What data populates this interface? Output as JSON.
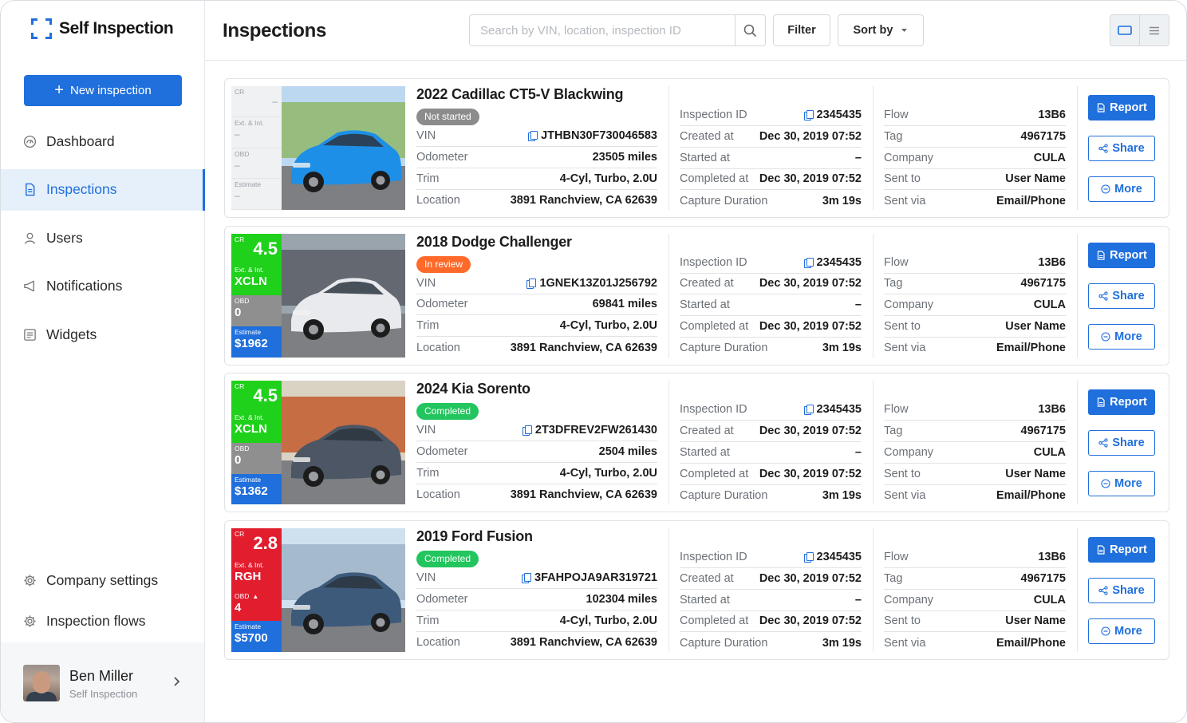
{
  "app": {
    "brand": "Self Inspection"
  },
  "sidebar": {
    "new_button": "New inspection",
    "nav": [
      {
        "id": "dashboard",
        "label": "Dashboard",
        "icon": "gauge-icon",
        "active": false
      },
      {
        "id": "inspections",
        "label": "Inspections",
        "icon": "document-icon",
        "active": true
      },
      {
        "id": "users",
        "label": "Users",
        "icon": "user-icon",
        "active": false
      },
      {
        "id": "notifications",
        "label": "Notifications",
        "icon": "megaphone-icon",
        "active": false
      },
      {
        "id": "widgets",
        "label": "Widgets",
        "icon": "widget-icon",
        "active": false
      }
    ],
    "bottom_nav": [
      {
        "id": "company-settings",
        "label": "Company settings",
        "icon": "gear-icon"
      },
      {
        "id": "inspection-flows",
        "label": "Inspection flows",
        "icon": "gear-icon"
      }
    ],
    "user": {
      "name": "Ben Miller",
      "subtitle": "Self Inspection"
    }
  },
  "header": {
    "title": "Inspections",
    "search_placeholder": "Search by VIN, location, inspection ID",
    "filter_label": "Filter",
    "sort_label": "Sort by"
  },
  "labels": {
    "vin": "VIN",
    "odometer": "Odometer",
    "trim": "Trim",
    "location": "Location",
    "inspection_id": "Inspection  ID",
    "created_at": "Created at",
    "started_at": "Started at",
    "completed_at": "Completed at",
    "capture_duration": "Capture Duration",
    "flow": "Flow",
    "tag": "Tag",
    "company": "Company",
    "sent_to": "Sent to",
    "sent_via": "Sent via",
    "report": "Report",
    "share": "Share",
    "more": "More",
    "cr": "CR",
    "ext_int": "Ext. & Int.",
    "obd": "OBD",
    "estimate": "Estimate"
  },
  "colors": {
    "accent": "#1f6fdc",
    "green": "#22c55e",
    "lime": "#1fd11a",
    "gray": "#8f8f8f",
    "red": "#e11d2e",
    "orange": "#ff6a2b",
    "status_gray": "#8c8c8c"
  },
  "inspections": [
    {
      "title": "2022 Cadillac CT5-V Blackwing",
      "status": "Not started",
      "status_color": "#8c8c8c",
      "scores": {
        "cr": "–",
        "ext_int": "–",
        "obd": "–",
        "estimate": "–",
        "empty": true
      },
      "photo_color": "#1e8fe6",
      "vin": "JTHBN30F730046583",
      "odometer": "23505 miles",
      "trim": "4-Cyl, Turbo, 2.0U",
      "location": "3891 Ranchview, CA 62639",
      "inspection_id": "2345435",
      "created_at": "Dec 30, 2019 07:52",
      "started_at": "–",
      "completed_at": "Dec 30, 2019 07:52",
      "capture_duration": "3m 19s",
      "flow": "13B6",
      "tag": "4967175",
      "company": "CULA",
      "sent_to": "User Name",
      "sent_via": "Email/Phone"
    },
    {
      "title": "2018 Dodge Challenger",
      "status": "In review",
      "status_color": "#ff6a2b",
      "scores": {
        "cr": "4.5",
        "ext_int": "XCLN",
        "obd": "0",
        "estimate": "$1962",
        "cr_color": "#1fd11a",
        "ext_color": "#1fd11a",
        "obd_color": "#8f8f8f",
        "est_color": "#1f6fdc",
        "obd_warn": false,
        "empty": false
      },
      "photo_color": "#e8eaed",
      "vin": "1GNEK13Z01J256792",
      "odometer": "69841 miles",
      "trim": "4-Cyl, Turbo, 2.0U",
      "location": "3891 Ranchview, CA 62639",
      "inspection_id": "2345435",
      "created_at": "Dec 30, 2019 07:52",
      "started_at": "–",
      "completed_at": "Dec 30, 2019 07:52",
      "capture_duration": "3m 19s",
      "flow": "13B6",
      "tag": "4967175",
      "company": "CULA",
      "sent_to": "User Name",
      "sent_via": "Email/Phone"
    },
    {
      "title": "2024 Kia Sorento",
      "status": "Completed",
      "status_color": "#22c55e",
      "scores": {
        "cr": "4.5",
        "ext_int": "XCLN",
        "obd": "0",
        "estimate": "$1362",
        "cr_color": "#1fd11a",
        "ext_color": "#1fd11a",
        "obd_color": "#8f8f8f",
        "est_color": "#1f6fdc",
        "obd_warn": false,
        "empty": false
      },
      "photo_color": "#4c5664",
      "vin": "2T3DFREV2FW261430",
      "odometer": "2504 miles",
      "trim": "4-Cyl, Turbo, 2.0U",
      "location": "3891 Ranchview, CA 62639",
      "inspection_id": "2345435",
      "created_at": "Dec 30, 2019 07:52",
      "started_at": "–",
      "completed_at": "Dec 30, 2019 07:52",
      "capture_duration": "3m 19s",
      "flow": "13B6",
      "tag": "4967175",
      "company": "CULA",
      "sent_to": "User Name",
      "sent_via": "Email/Phone"
    },
    {
      "title": "2019 Ford Fusion",
      "status": "Completed",
      "status_color": "#22c55e",
      "scores": {
        "cr": "2.8",
        "ext_int": "RGH",
        "obd": "4",
        "estimate": "$5700",
        "cr_color": "#e11d2e",
        "ext_color": "#e11d2e",
        "obd_color": "#e11d2e",
        "est_color": "#1f6fdc",
        "obd_warn": true,
        "empty": false
      },
      "photo_color": "#3d5a7a",
      "vin": "3FAHPOJA9AR319721",
      "odometer": "102304 miles",
      "trim": "4-Cyl, Turbo, 2.0U",
      "location": "3891 Ranchview, CA 62639",
      "inspection_id": "2345435",
      "created_at": "Dec 30, 2019 07:52",
      "started_at": "–",
      "completed_at": "Dec 30, 2019 07:52",
      "capture_duration": "3m 19s",
      "flow": "13B6",
      "tag": "4967175",
      "company": "CULA",
      "sent_to": "User Name",
      "sent_via": "Email/Phone"
    }
  ]
}
